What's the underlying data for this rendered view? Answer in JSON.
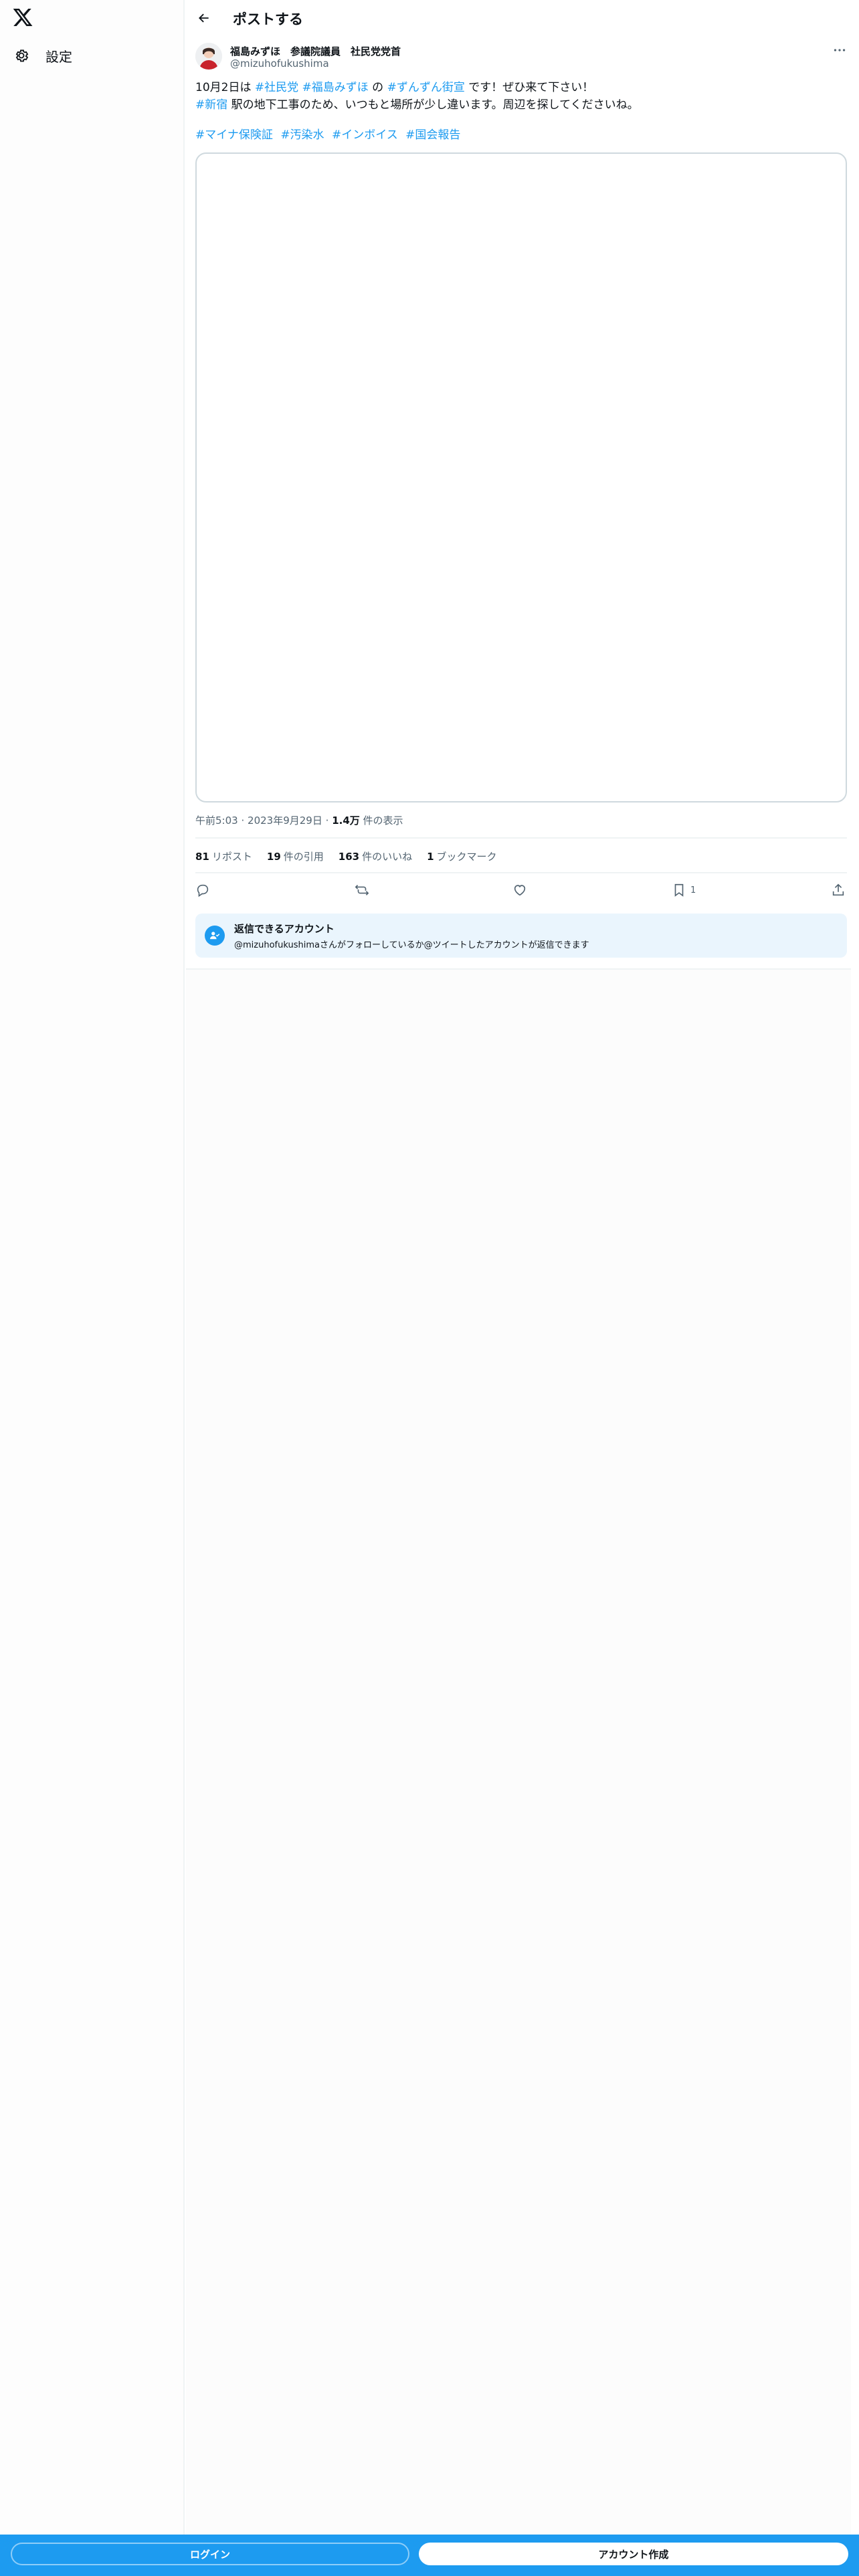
{
  "nav": {
    "logo_icon": "x-logo-icon",
    "settings_label": "設定",
    "settings_icon": "gear-icon"
  },
  "header": {
    "title": "ポストする",
    "back_icon": "arrow-left-icon"
  },
  "post": {
    "author_name": "福島みずほ　参議院議員　社民党党首",
    "author_handle": "@mizuhofukushima",
    "more_icon": "more-horizontal-icon",
    "text": {
      "t1": "10月2日は ",
      "tag1": "#社民党",
      "tag2": "#福島みずほ",
      "t2": " の ",
      "tag3": "#ずんずん街宣",
      "t3": " です！ぜひ来て下さい！",
      "tag4": "#新宿",
      "t4": " 駅の地下工事のため、いつもと場所が少し違います。周辺を探してくださいね。"
    },
    "hashtags": [
      "#マイナ保険証",
      "#汚染水",
      "#インボイス",
      "#国会報告"
    ],
    "meta": {
      "time": "午前5:03",
      "sep": "·",
      "date": "2023年9月29日",
      "views_count": "1.4万",
      "views_label": "件の表示"
    },
    "stats": {
      "reposts_count": "81",
      "reposts_label": "リポスト",
      "quotes_count": "19",
      "quotes_label": "件の引用",
      "likes_count": "163",
      "likes_label": "件のいいね",
      "bookmarks_count": "1",
      "bookmarks_label": "ブックマーク"
    },
    "actions": {
      "reply_icon": "reply-icon",
      "repost_icon": "repost-icon",
      "like_icon": "heart-icon",
      "bookmark_icon": "bookmark-icon",
      "bookmark_count": "1",
      "share_icon": "share-icon"
    }
  },
  "reply_restriction": {
    "icon": "user-check-icon",
    "title": "返信できるアカウント",
    "description": "@mizuhofukushimaさんがフォローしているか@ツイートしたアカウントが返信できます"
  },
  "bottom_bar": {
    "login_label": "ログイン",
    "signup_label": "アカウント作成"
  },
  "colors": {
    "accent": "#1d9bf0",
    "text": "#0f1419",
    "secondary_text": "#536471",
    "reply_box_bg": "#eaf5fd"
  }
}
